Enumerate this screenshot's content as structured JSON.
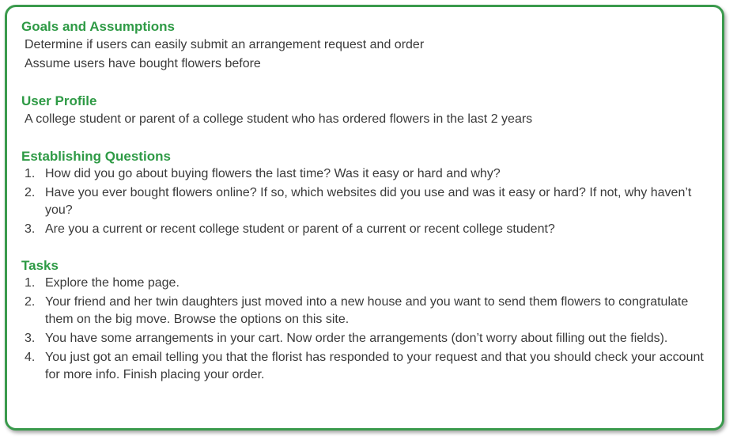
{
  "goals": {
    "heading": "Goals and Assumptions",
    "lines": [
      "Determine if users can easily submit an arrangement request and order",
      "Assume users have bought flowers before"
    ]
  },
  "profile": {
    "heading": "User Profile",
    "lines": [
      "A college student or parent of a college student who has ordered flowers in the last 2 years"
    ]
  },
  "questions": {
    "heading": "Establishing Questions",
    "items": [
      {
        "num": "1.",
        "text": "How did you go about buying flowers the last time? Was it easy or hard and why?"
      },
      {
        "num": "2.",
        "text": "Have you ever bought flowers online? If so, which websites did you use and was it easy or hard? If not, why haven’t you?"
      },
      {
        "num": "3.",
        "text": "Are you a current or recent college student or parent of a current or recent college student?"
      }
    ]
  },
  "tasks": {
    "heading": "Tasks",
    "items": [
      {
        "num": "1.",
        "text": "Explore the home page."
      },
      {
        "num": "2.",
        "text": "Your friend and her twin daughters just moved into a new house and you want to send them flowers to congratulate them on the big move. Browse the options on this site."
      },
      {
        "num": "3.",
        "text": "You have some arrangements in your cart. Now order the arrangements (don’t worry about filling out the fields)."
      },
      {
        "num": "4.",
        "text": "You just got an email telling you that the florist has responded to your request and that you should check your account for more info. Finish placing your order."
      }
    ]
  }
}
